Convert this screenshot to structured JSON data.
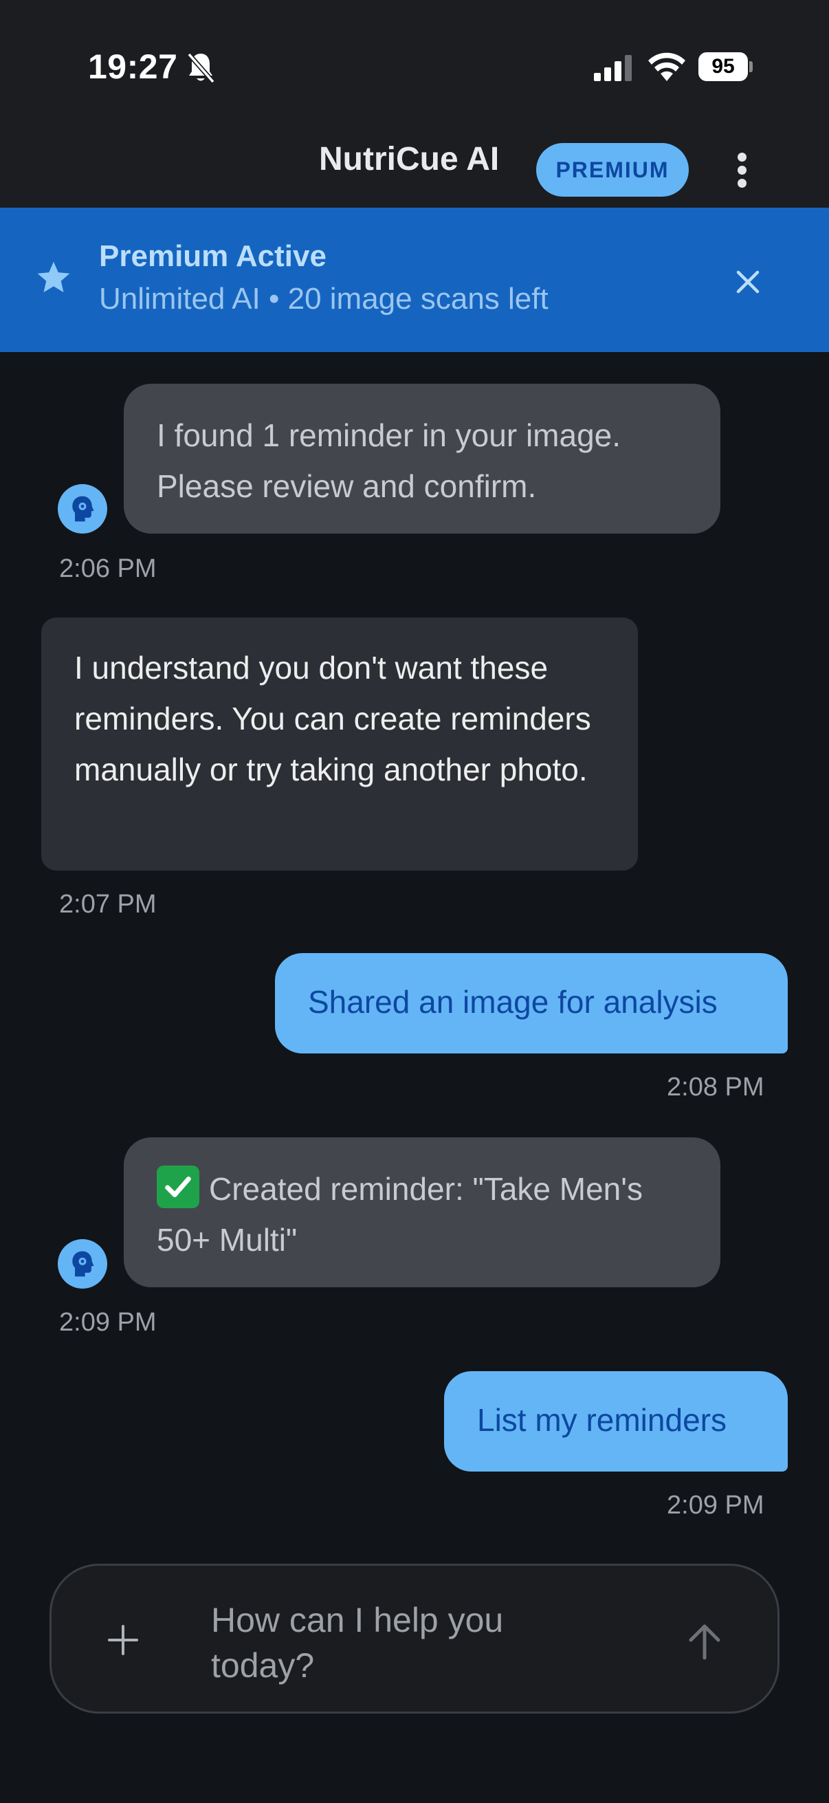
{
  "status_bar": {
    "time": "19:27",
    "battery": "95",
    "icons": [
      "bell-off-icon",
      "signal-icon",
      "wifi-icon",
      "battery-icon"
    ]
  },
  "header": {
    "title": "NutriCue AI",
    "badge": "PREMIUM",
    "menu_icon": "more-vertical-icon"
  },
  "banner": {
    "icon": "star-icon",
    "title": "Premium Active",
    "subtitle": "Unlimited AI • 20 image scans left",
    "close_icon": "close-icon"
  },
  "messages": [
    {
      "sender": "bot",
      "text": "I found 1 reminder in your image. Please review and confirm.",
      "time": "2:06 PM"
    },
    {
      "sender": "assistant",
      "text": "I understand you don't want these reminders. You can create reminders manually or try taking another photo.",
      "time": "2:07 PM"
    },
    {
      "sender": "user",
      "text": "Shared an image for analysis",
      "time": "2:08 PM"
    },
    {
      "sender": "bot",
      "prefix_icon": "check-mark-icon",
      "text": "Created reminder: \"Take Men's 50+ Multi\"",
      "time": "2:09 PM"
    },
    {
      "sender": "user",
      "text": "List my reminders",
      "time": "2:09 PM"
    }
  ],
  "composer": {
    "placeholder": "How can I help you today?",
    "add_icon": "plus-icon",
    "send_icon": "arrow-up-icon"
  },
  "colors": {
    "background": "#111418",
    "banner": "#1565c0",
    "accent": "#64b5f6",
    "user_text": "#0d47a1"
  }
}
